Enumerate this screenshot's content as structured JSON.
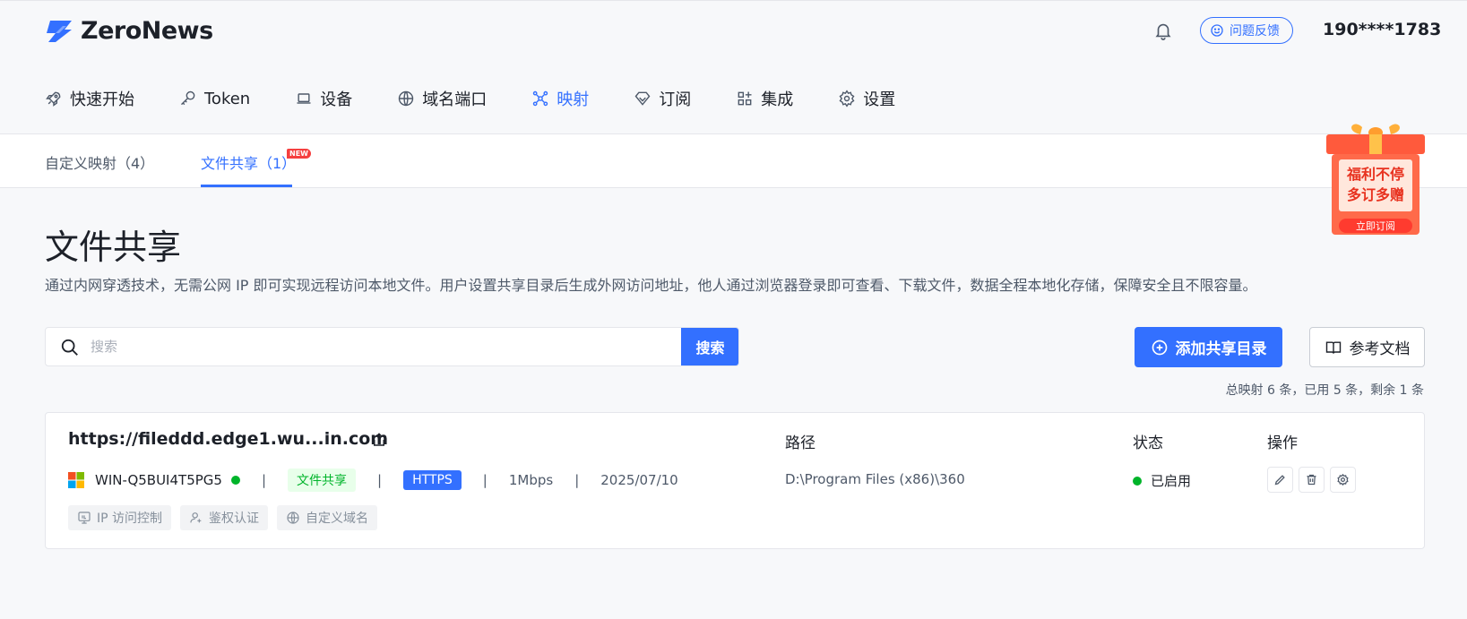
{
  "app": {
    "name": "ZeroNews"
  },
  "header": {
    "feedback_label": "问题反馈",
    "user_phone": "190****1783"
  },
  "nav": {
    "items": [
      {
        "label": "快速开始",
        "icon": "rocket-icon"
      },
      {
        "label": "Token",
        "icon": "key-icon"
      },
      {
        "label": "设备",
        "icon": "laptop-icon"
      },
      {
        "label": "域名端口",
        "icon": "globe-icon"
      },
      {
        "label": "映射",
        "icon": "mapping-icon",
        "active": true
      },
      {
        "label": "订阅",
        "icon": "diamond-icon"
      },
      {
        "label": "集成",
        "icon": "apps-icon"
      },
      {
        "label": "设置",
        "icon": "gear-icon"
      }
    ]
  },
  "subtabs": {
    "custom": "自定义映射（4）",
    "fileshare": "文件共享（1）",
    "new_badge": "NEW"
  },
  "promo": {
    "line1": "福利不停",
    "line2": "多订多赠",
    "cta": "立即订阅"
  },
  "page": {
    "title": "文件共享",
    "description": "通过内网穿透技术，无需公网 IP 即可实现远程访问本地文件。用户设置共享目录后生成外网访问地址，他人通过浏览器登录即可查看、下载文件，数据全程本地化存储，保障安全且不限容量。"
  },
  "search": {
    "placeholder": "搜索",
    "button": "搜索"
  },
  "actions": {
    "add": "添加共享目录",
    "docs": "参考文档"
  },
  "quota": "总映射 6 条，已用 5 条，剩余 1 条",
  "columns": {
    "path": "路径",
    "status": "状态",
    "ops": "操作"
  },
  "mapping": {
    "url": "https://fileddd.edge1.wu...in.com",
    "device": "WIN-Q5BUI4T5PG5",
    "type_tag": "文件共享",
    "protocol": "HTTPS",
    "bandwidth": "1Mbps",
    "date": "2025/07/10",
    "path": "D:\\Program Files (x86)\\360",
    "status": "已启用",
    "features": [
      {
        "label": "IP 访问控制",
        "icon": "ip-control-icon"
      },
      {
        "label": "鉴权认证",
        "icon": "user-auth-icon"
      },
      {
        "label": "自定义域名",
        "icon": "globe-icon"
      }
    ]
  },
  "colors": {
    "accent": "#3370ff",
    "online": "#00b42a",
    "badge": "#f53f3f"
  }
}
